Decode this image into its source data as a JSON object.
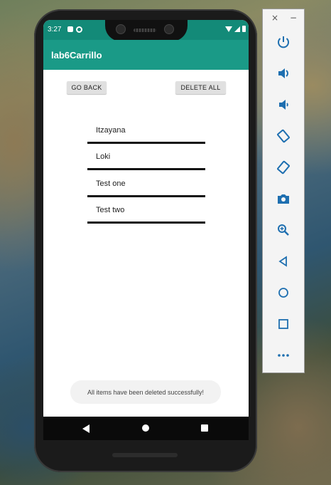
{
  "status": {
    "time": "3:27"
  },
  "app": {
    "title": "lab6Carrillo"
  },
  "buttons": {
    "go_back": "GO BACK",
    "delete_all": "DELETE ALL"
  },
  "items": [
    "Itzayana",
    "Loki",
    "Test one",
    "Test two"
  ],
  "toast": "All items have been deleted successfully!",
  "emulator": {
    "close": "×",
    "minimize": "−",
    "tools": [
      "power-icon",
      "volume-up-icon",
      "volume-down-icon",
      "rotate-left-icon",
      "rotate-right-icon",
      "camera-icon",
      "zoom-icon",
      "back-icon",
      "home-icon",
      "overview-icon",
      "more-icon"
    ]
  },
  "colors": {
    "appbar": "#1a9a87",
    "statusbar": "#138a78",
    "toolbar_icon": "#1e6fb0"
  }
}
